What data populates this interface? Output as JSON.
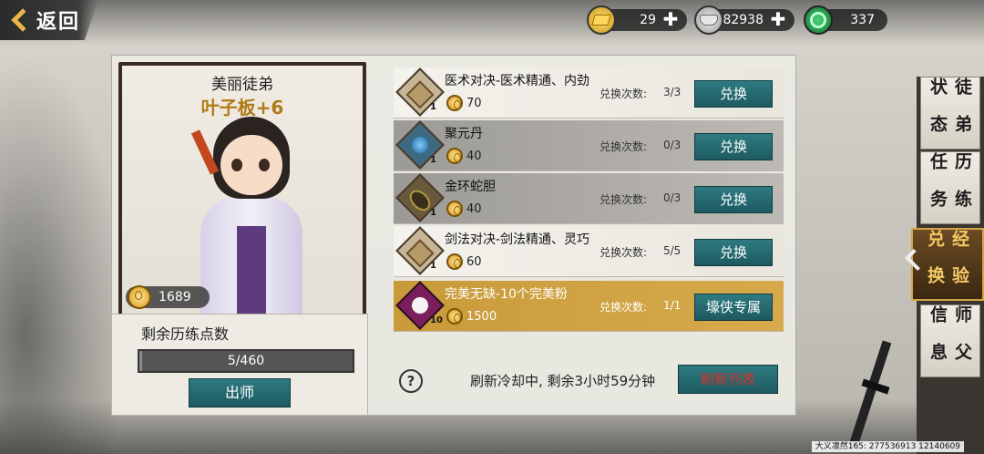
{
  "topbar": {
    "back_label": "返回",
    "currencies": [
      {
        "icon": "gold-ingot-icon",
        "value": "29"
      },
      {
        "icon": "silver-ingot-icon",
        "value": "82938"
      },
      {
        "icon": "jade-coin-icon",
        "value": "337"
      }
    ],
    "add_symbol": "✚"
  },
  "side_tabs": [
    {
      "label": "徒弟状态",
      "col1": "弟态",
      "col2": "徒状",
      "active": false
    },
    {
      "label": "历练任务",
      "col1": "练务",
      "col2": "历任",
      "active": false
    },
    {
      "label": "经验兑换",
      "col1": "验换",
      "col2": "经兑",
      "active": true
    },
    {
      "label": "师父信息",
      "col1": "父息",
      "col2": "师信",
      "active": false
    }
  ],
  "disciple": {
    "subtitle": "美丽徒弟",
    "name": "叶子板+6",
    "coins": "1689"
  },
  "points": {
    "title": "剩余历练点数",
    "value": "5/460",
    "progress": 0.011,
    "graduate_label": "出师"
  },
  "exchange": {
    "count_label": "兑换次数:",
    "items": [
      {
        "name": "医术对决-医术精通、内劲",
        "qty": "1",
        "cost": "70",
        "count": "3/3",
        "button": "兑换",
        "icon": "scroll-icon",
        "style": "light"
      },
      {
        "name": "聚元丹",
        "qty": "1",
        "cost": "40",
        "count": "0/3",
        "button": "兑换",
        "icon": "pill-icon",
        "style": "dark"
      },
      {
        "name": "金环蛇胆",
        "qty": "1",
        "cost": "40",
        "count": "0/3",
        "button": "兑换",
        "icon": "snake-gall-icon",
        "style": "dark"
      },
      {
        "name": "剑法对决-剑法精通、灵巧",
        "qty": "1",
        "cost": "60",
        "count": "5/5",
        "button": "兑换",
        "icon": "scroll-icon",
        "style": "light"
      },
      {
        "name": "完美无缺-10个完美粉",
        "qty": "10",
        "cost": "1500",
        "count": "1/1",
        "button": "壕侠专属",
        "icon": "powder-icon",
        "style": "gold"
      }
    ]
  },
  "footer": {
    "help_symbol": "?",
    "refresh_text": "刷新冷却中, 剩余3小时59分钟",
    "refresh_button": "刷新列表"
  },
  "watermark": "大义凛然165: 277536913 12140609",
  "colors": {
    "button_teal": "#2f7a82",
    "gold_text": "#b07a16",
    "refresh_red": "#d8322a",
    "highlight_row": "#c99a3a"
  }
}
